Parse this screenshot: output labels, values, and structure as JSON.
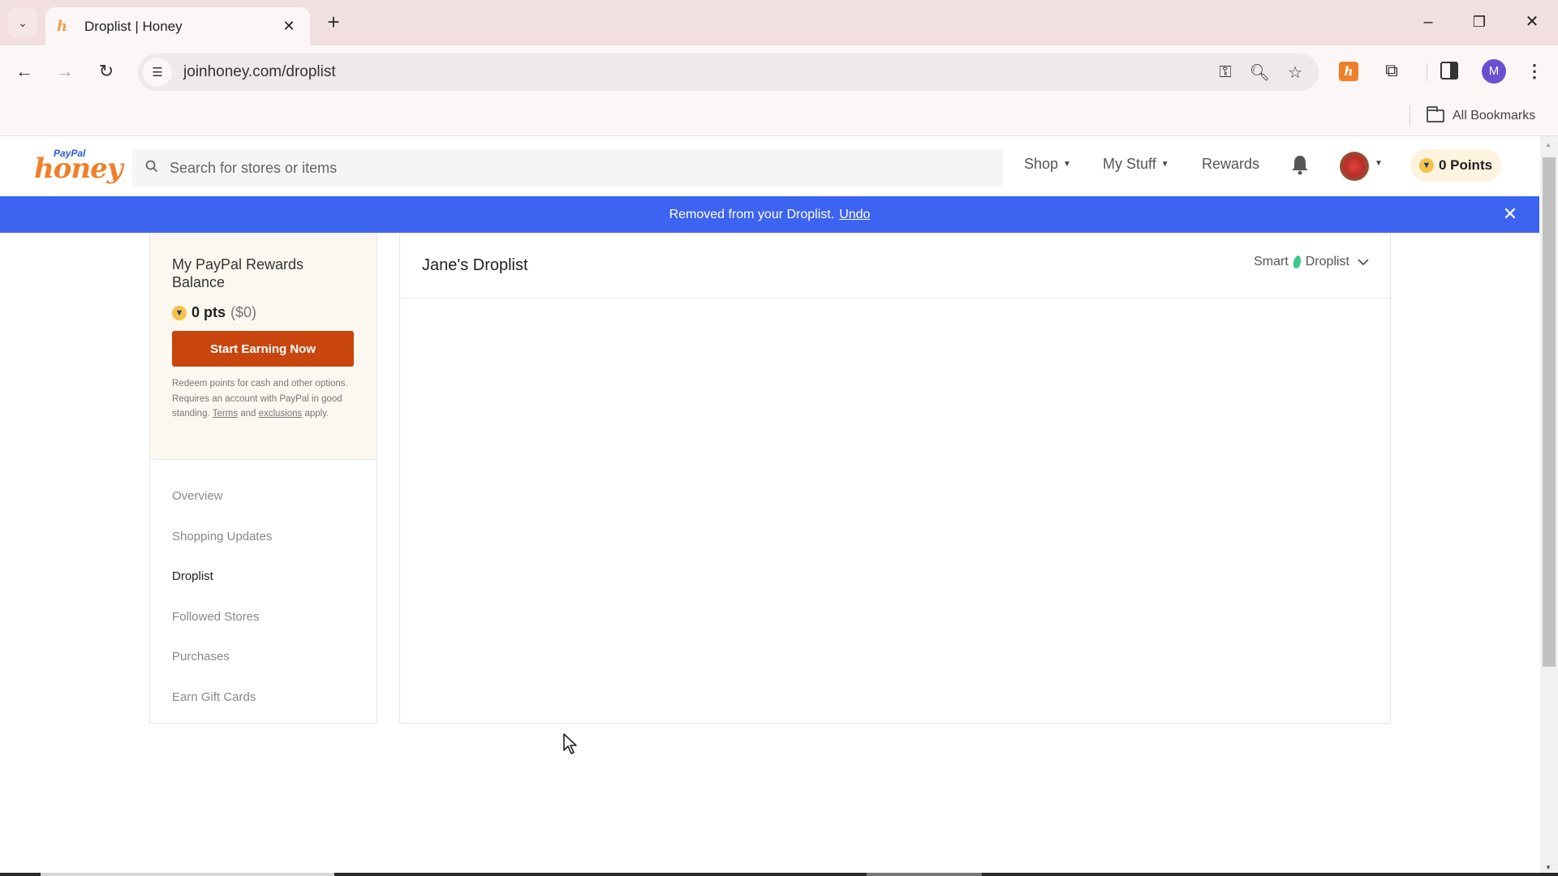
{
  "browser": {
    "tab": {
      "favicon": "honey-h-icon",
      "title": "Droplist | Honey",
      "close_glyph": "✕"
    },
    "new_tab_glyph": "+",
    "tab_list_glyph": "⌄",
    "window_controls": {
      "minimize": "–",
      "restore": "❐",
      "close": "✕"
    },
    "nav": {
      "back": "←",
      "forward": "→",
      "reload": "↻"
    },
    "url": "joinhoney.com/droplist",
    "omnibox_icons": [
      "key-icon",
      "zoom-icon",
      "star-icon"
    ],
    "omnibox_glyphs": {
      "key": "⚿",
      "zoom": "🔍︎",
      "star": "☆"
    },
    "extension_honey_glyph": "h",
    "extension_puzzle_glyph": "⧉",
    "profile_initial": "M",
    "menu_glyph": "⋮",
    "bookmarks": {
      "all_bookmarks": "All Bookmarks"
    }
  },
  "site": {
    "logo": {
      "top": "PayPal",
      "main": "honey"
    },
    "search": {
      "placeholder": "Search for stores or items",
      "value": "",
      "icon_glyph": "⚲"
    },
    "nav": [
      {
        "label": "Shop",
        "has_caret": true
      },
      {
        "label": "My Stuff",
        "has_caret": true
      },
      {
        "label": "Rewards",
        "has_caret": false
      }
    ],
    "caret_glyph": "▼",
    "bell_glyph": "🔔︎",
    "points_badge": {
      "label": "0 Points",
      "icon_glyph": "🏆︎"
    }
  },
  "banner": {
    "message": "Removed from your Droplist.",
    "action": "Undo",
    "close_glyph": "✕",
    "color": "#3d63f1"
  },
  "sidebar": {
    "rewards": {
      "title": "My PayPal Rewards Balance",
      "points": "0 pts",
      "dollars": "($0)",
      "cta": "Start Earning Now",
      "cta_color": "#c8460d",
      "fine_print_1": "Redeem points for cash and other options. Requires an account with PayPal in good standing.",
      "terms_link": "Terms",
      "fine_print_2": "and",
      "exclusions_link": "exclusions",
      "fine_print_3": "apply."
    },
    "items": [
      {
        "label": "Overview",
        "active": false
      },
      {
        "label": "Shopping Updates",
        "active": false
      },
      {
        "label": "Droplist",
        "active": true
      },
      {
        "label": "Followed Stores",
        "active": false
      },
      {
        "label": "Purchases",
        "active": false
      },
      {
        "label": "Earn Gift Cards",
        "active": false
      }
    ]
  },
  "main": {
    "title": "Jane's Droplist",
    "view_toggle": {
      "part1": "Smart",
      "part2": "Droplist",
      "chevron_glyph": "⌄"
    }
  },
  "scrollbar": {
    "up_glyph": "▲",
    "down_glyph": "▼"
  }
}
